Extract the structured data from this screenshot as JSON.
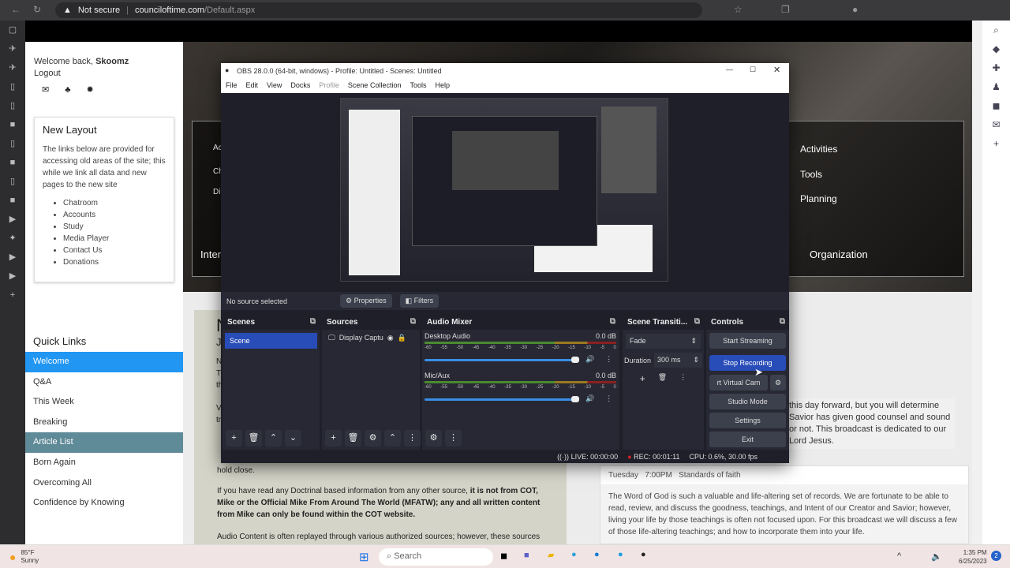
{
  "browser": {
    "security": "Not secure",
    "url_host": "counciloftime.com",
    "url_path": "/Default.aspx"
  },
  "site": {
    "welcome_prefix": "Welcome back, ",
    "username": "Skoomz",
    "logout": "Logout",
    "layout_card": {
      "title": "New Layout",
      "text": "The links below are provided for accessing old areas of the site; this while we link all data and new pages to the new site",
      "links": [
        "Chatroom",
        "Accounts",
        "Study",
        "Media Player",
        "Contact Us",
        "Donations"
      ]
    },
    "quick_links": {
      "title": "Quick Links",
      "items": [
        "Welcome",
        "Q&A",
        "This Week",
        "Breaking",
        "Article List",
        "Born Again",
        "Overcoming All",
        "Confidence by Knowing"
      ]
    },
    "hero": {
      "right_items": [
        "Activities",
        "Tools",
        "Planning"
      ],
      "left_items": [
        "Ac",
        "Ch",
        "Di"
      ],
      "left_label": "Inter",
      "right_label": "Organization"
    },
    "content": {
      "heading": "N",
      "sub": "Ju",
      "p_fragments": [
        "N",
        "T",
        "th",
        "V",
        "tr",
        "hold close."
      ],
      "para1_normal": "If you have read any Doctrinal based information from any other source, ",
      "para1_bold": "it is not from COT, Mike or the Official Mike From Around The World (MFATW); any and all written content from Mike can only be found within the COT website.",
      "para2": "Audio Content is often replayed through various authorized sources; however, these sources"
    },
    "right_text": "this day forward, but you will determine Savior has given good counsel and sound or not. This broadcast is dedicated to our Lord Jesus.",
    "event": {
      "day": "Tuesday",
      "time": "7:00PM",
      "title": "Standards of faith",
      "body": "The Word of God is such a valuable and life-altering set of records. We are fortunate to be able to read, review, and discuss the goodness, teachings, and Intent of our Creator and Savior; however, living your life by those teachings is often not focused upon. For this broadcast we will discuss a few of those life-altering teachings; and how to incorporate them into your life."
    }
  },
  "obs": {
    "title": "OBS 28.0.0 (64-bit, windows) - Profile: Untitled - Scenes: Untitled",
    "menu": [
      "File",
      "Edit",
      "View",
      "Docks",
      "Profile",
      "Scene Collection",
      "Tools",
      "Help"
    ],
    "no_source": "No source selected",
    "properties": "Properties",
    "filters": "Filters",
    "scenes": {
      "title": "Scenes",
      "items": [
        "Scene"
      ]
    },
    "sources": {
      "title": "Sources",
      "items": [
        "Display Captu"
      ]
    },
    "mixer": {
      "title": "Audio Mixer",
      "channels": [
        {
          "name": "Desktop Audio",
          "level": "0.0 dB"
        },
        {
          "name": "Mic/Aux",
          "level": "0.0 dB"
        }
      ],
      "ticks": [
        "-60",
        "-55",
        "-50",
        "-45",
        "-40",
        "-35",
        "-30",
        "-25",
        "-20",
        "-15",
        "-10",
        "-5",
        "0"
      ]
    },
    "transitions": {
      "title": "Scene Transiti...",
      "type": "Fade",
      "duration_label": "Duration",
      "duration": "300 ms"
    },
    "controls": {
      "title": "Controls",
      "buttons": [
        "Start Streaming",
        "Stop Recording",
        "rt Virtual Cam",
        "Studio Mode",
        "Settings",
        "Exit"
      ]
    },
    "status": {
      "live": "LIVE: 00:00:00",
      "rec": "REC: 00:01:11",
      "cpu": "CPU: 0.6%, 30.00 fps"
    }
  },
  "taskbar": {
    "weather_temp": "85°F",
    "weather_desc": "Sunny",
    "search": "Search",
    "time": "1:35 PM",
    "date": "6/25/2023",
    "notifications": "2"
  }
}
